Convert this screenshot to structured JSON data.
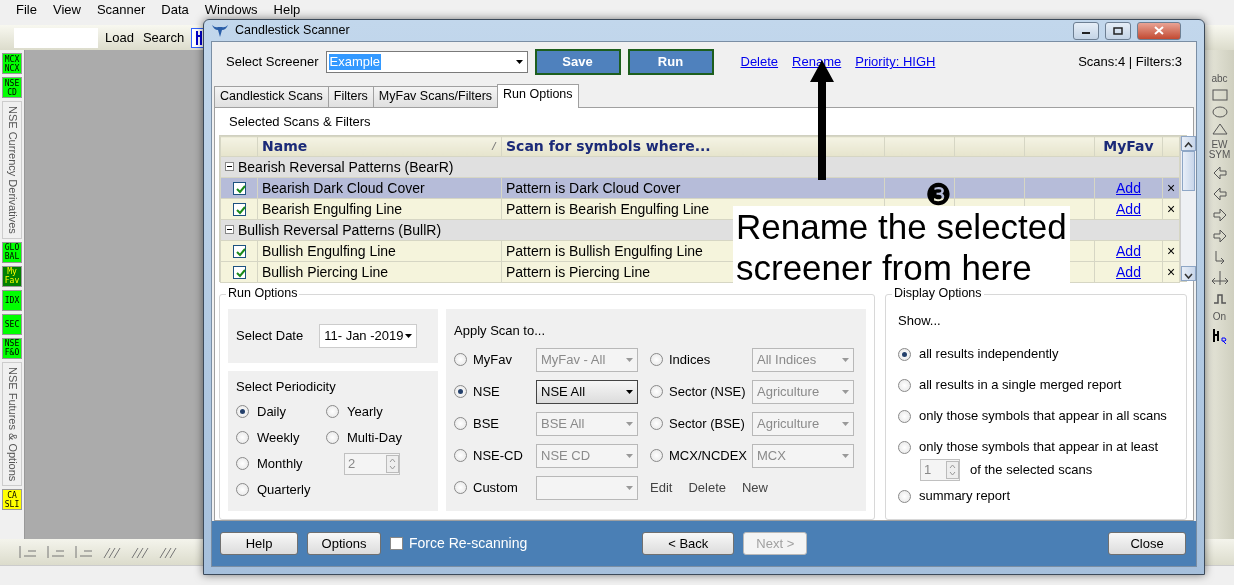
{
  "menu": [
    "File",
    "View",
    "Scanner",
    "Data",
    "Windows",
    "Help"
  ],
  "toolbar": {
    "buttons": [
      "Load",
      "Search"
    ]
  },
  "left_strip": [
    {
      "kind": "badge",
      "lines": [
        "MCX",
        "NCX"
      ],
      "color": "#00ff00"
    },
    {
      "kind": "badge",
      "lines": [
        "NSE",
        "CD"
      ],
      "color": "#00ff00"
    },
    {
      "kind": "label",
      "text": "NSE Currency Derivatives"
    },
    {
      "kind": "badge",
      "lines": [
        "GLO",
        "BAL"
      ],
      "color": "#00ff00"
    },
    {
      "kind": "badge",
      "lines": [
        "My",
        "Fav"
      ],
      "color": "#008000"
    },
    {
      "kind": "badge",
      "lines": [
        "IDX"
      ],
      "color": "#00ff00"
    },
    {
      "kind": "badge",
      "lines": [
        "SEC"
      ],
      "color": "#00ff00"
    },
    {
      "kind": "badge",
      "lines": [
        "NSE",
        "F&O"
      ],
      "color": "#00ff00"
    },
    {
      "kind": "label",
      "text": "NSE Futures & Options"
    },
    {
      "kind": "badge",
      "lines": [
        "CA",
        "SLI"
      ],
      "color": "#ffff00"
    }
  ],
  "right_toolbar": {
    "texts": [
      "abc",
      "EW SYM",
      "On"
    ]
  },
  "dialog": {
    "title": "Candlestick Scanner",
    "screener_label": "Select Screener",
    "screener_value": "Example",
    "buttons": [
      "Save",
      "Run"
    ],
    "links": [
      "Delete",
      "Rename",
      "Priority: HIGH"
    ],
    "counts": "Scans:4 | Filters:3",
    "tabs": [
      {
        "label": "Candlestick Scans",
        "selected": false
      },
      {
        "label": "Filters",
        "selected": false
      },
      {
        "label": "MyFav Scans/Filters",
        "selected": false
      },
      {
        "label": "Run Options",
        "selected": true
      }
    ],
    "section_title": "Selected Scans & Filters",
    "table": {
      "columns": [
        "Name",
        "Scan for symbols where...",
        "MyFav"
      ],
      "rows": [
        {
          "kind": "group",
          "label": "Bearish Reversal Patterns (BearR)",
          "expanded": true
        },
        {
          "kind": "scan",
          "checked": true,
          "name": "Bearish Dark Cloud Cover",
          "condition": "Pattern is Dark Cloud Cover",
          "action": "Add",
          "remove": "×",
          "selected": true
        },
        {
          "kind": "scan",
          "checked": true,
          "name": "Bearish Engulfing Line",
          "condition": "Pattern is Bearish Engulfing Line",
          "action": "Add",
          "remove": "×",
          "selected": false
        },
        {
          "kind": "group",
          "label": "Bullish Reversal Patterns (BullR)",
          "expanded": true
        },
        {
          "kind": "scan",
          "checked": true,
          "name": "Bullish Engulfing Line",
          "condition": "Pattern is Bullish Engulfing Line",
          "action": "Add",
          "remove": "×",
          "selected": false
        },
        {
          "kind": "scan",
          "checked": true,
          "name": "Bullish Piercing Line",
          "condition": "Pattern is Piercing Line",
          "action": "Add",
          "remove": "×",
          "selected": false
        }
      ]
    },
    "run_options": {
      "title": "Run Options",
      "date_label": "Select Date",
      "date_value": "11- Jan -2019",
      "periodicity_label": "Select Periodicity",
      "periodicity": [
        {
          "label": "Daily",
          "selected": true
        },
        {
          "label": "Yearly",
          "selected": false
        },
        {
          "label": "Weekly",
          "selected": false
        },
        {
          "label": "Multi-Day",
          "selected": false
        },
        {
          "label": "Monthly",
          "selected": false
        },
        {
          "label": "Quarterly",
          "selected": false
        }
      ],
      "multi_day": {
        "value": "2",
        "disabled": true
      },
      "apply_title": "Apply Scan to...",
      "apply_left": [
        {
          "label": "MyFav",
          "selected": false,
          "value": "MyFav - All",
          "disabled": true
        },
        {
          "label": "NSE",
          "selected": true,
          "value": "NSE All",
          "disabled": false
        },
        {
          "label": "BSE",
          "selected": false,
          "value": "BSE All",
          "disabled": true
        },
        {
          "label": "NSE-CD",
          "selected": false,
          "value": "NSE CD",
          "disabled": true
        },
        {
          "label": "Custom",
          "selected": false,
          "disabled": true
        }
      ],
      "apply_right": [
        {
          "label": "Indices",
          "selected": false,
          "value": "All Indices",
          "disabled": true
        },
        {
          "label": "Sector (NSE)",
          "selected": false,
          "value": "Agriculture",
          "disabled": true
        },
        {
          "label": "Sector (BSE)",
          "selected": false,
          "value": "Agriculture",
          "disabled": true
        },
        {
          "label": "MCX/NCDEX",
          "selected": false,
          "value": "MCX",
          "disabled": true
        }
      ],
      "custom_actions": [
        "Edit",
        "Delete",
        "New"
      ]
    },
    "display_options": {
      "title": "Display Options",
      "show_label": "Show...",
      "options": [
        {
          "label": "all results independently",
          "selected": true
        },
        {
          "label": "all results in a single merged report",
          "selected": false
        },
        {
          "label": "only those symbols that appear in all scans",
          "selected": false
        },
        {
          "label": "only those symbols that appear in at least",
          "selected": false
        },
        {
          "label": "summary report",
          "selected": false
        }
      ],
      "at_least": {
        "value": "1",
        "disabled": true,
        "suffix": "of the selected scans"
      }
    },
    "footer": {
      "help": "Help",
      "options": "Options",
      "force": {
        "label": "Force Re-scanning",
        "checked": false
      },
      "back": {
        "label": "< Back",
        "disabled": false
      },
      "next": {
        "label": "Next >",
        "disabled": true
      },
      "close": "Close"
    }
  },
  "annotation": {
    "marker": "❸",
    "lines": [
      "Rename the selected",
      "screener from here"
    ]
  }
}
